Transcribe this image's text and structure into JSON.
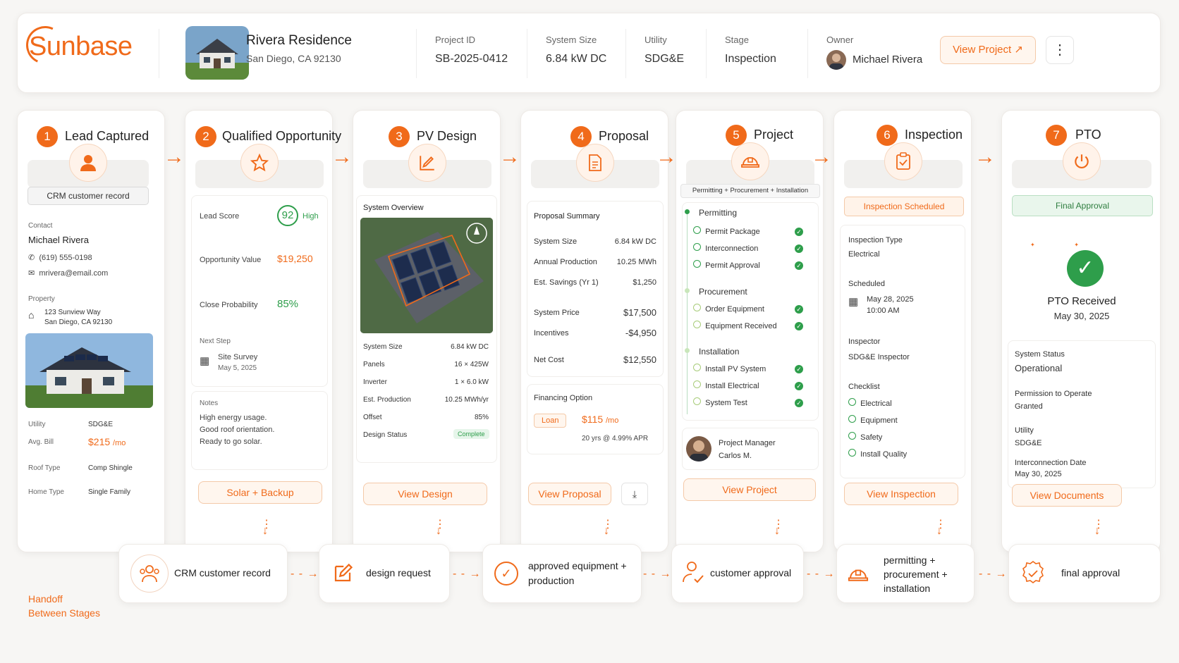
{
  "header": {
    "logo": "Sunbase",
    "project_name": "Rivera Residence",
    "address": "San Diego, CA 92130",
    "fields": [
      {
        "label": "Project ID",
        "value": "SB-2025-0412"
      },
      {
        "label": "System Size",
        "value": "6.84 kW DC"
      },
      {
        "label": "Utility",
        "value": "SDG&E"
      },
      {
        "label": "Stage",
        "value": "Inspection"
      }
    ],
    "owner_label": "Owner",
    "owner_name": "Michael Rivera",
    "view_project": "View Project"
  },
  "stages": [
    {
      "num": "1",
      "title": "Lead Captured",
      "icon": "user-icon"
    },
    {
      "num": "2",
      "title": "Qualified Opportunity",
      "icon": "star-icon"
    },
    {
      "num": "3",
      "title": "PV Design",
      "icon": "design-pencil-icon"
    },
    {
      "num": "4",
      "title": "Proposal",
      "icon": "document-icon"
    },
    {
      "num": "5",
      "title": "Project",
      "icon": "hardhat-icon"
    },
    {
      "num": "6",
      "title": "Inspection",
      "icon": "clipboard-check-icon"
    },
    {
      "num": "7",
      "title": "PTO",
      "icon": "power-icon"
    }
  ],
  "lead": {
    "badge": "CRM customer record",
    "contact_label": "Contact",
    "name": "Michael Rivera",
    "phone": "(619) 555-0198",
    "email": "mrivera@email.com",
    "property_label": "Property",
    "street": "123 Sunview Way",
    "city": "San Diego, CA 92130",
    "utility_label": "Utility",
    "utility": "SDG&E",
    "bill_label": "Avg. Bill",
    "bill": "$215",
    "bill_unit": "/mo",
    "roof_label": "Roof Type",
    "roof": "Comp Shingle",
    "home_label": "Home Type",
    "home": "Single Family"
  },
  "qualified": {
    "score_label": "Lead Score",
    "score": "92",
    "score_level": "High",
    "value_label": "Opportunity Value",
    "value": "$19,250",
    "prob_label": "Close Probability",
    "prob": "85%",
    "next_label": "Next Step",
    "next": "Site Survey",
    "next_date": "May 5, 2025",
    "notes_label": "Notes",
    "notes": [
      "High energy usage.",
      "Good roof orientation.",
      "Ready to go solar."
    ],
    "button": "Solar + Backup"
  },
  "design": {
    "overview": "System Overview",
    "rows": [
      {
        "k": "System Size",
        "v": "6.84 kW DC"
      },
      {
        "k": "Panels",
        "v": "16 × 425W"
      },
      {
        "k": "Inverter",
        "v": "1 × 6.0 kW"
      },
      {
        "k": "Est. Production",
        "v": "10.25 MWh/yr"
      },
      {
        "k": "Offset",
        "v": "85%"
      }
    ],
    "status_label": "Design Status",
    "status": "Complete",
    "button": "View Design"
  },
  "proposal": {
    "summary": "Proposal Summary",
    "rows": [
      {
        "k": "System Size",
        "v": "6.84 kW DC"
      },
      {
        "k": "Annual Production",
        "v": "10.25 MWh"
      },
      {
        "k": "Est. Savings (Yr 1)",
        "v": "$1,250"
      }
    ],
    "price_label": "System Price",
    "price": "$17,500",
    "inc_label": "Incentives",
    "inc": "-$4,950",
    "net_label": "Net Cost",
    "net": "$12,550",
    "fin_label": "Financing Option",
    "loan": "Loan",
    "monthly": "$115",
    "monthly_unit": "/mo",
    "terms": "20 yrs @ 4.99% APR",
    "button": "View Proposal"
  },
  "project": {
    "tag": "Permitting + Procurement + Installation",
    "groups": [
      {
        "title": "Permitting",
        "items": [
          "Permit Package",
          "Interconnection",
          "Permit Approval"
        ]
      },
      {
        "title": "Procurement",
        "items": [
          "Order Equipment",
          "Equipment Received"
        ]
      },
      {
        "title": "Installation",
        "items": [
          "Install PV System",
          "Install Electrical",
          "System Test"
        ]
      }
    ],
    "pm_label": "Project Manager",
    "pm": "Carlos M.",
    "button": "View Project"
  },
  "inspection": {
    "badge": "Inspection Scheduled",
    "type_label": "Inspection Type",
    "type": "Electrical",
    "sched_label": "Scheduled",
    "date": "May 28, 2025",
    "time": "10:00 AM",
    "inspector_label": "Inspector",
    "inspector": "SDG&E Inspector",
    "checklist_label": "Checklist",
    "checklist": [
      "Electrical",
      "Equipment",
      "Safety",
      "Install Quality"
    ],
    "button": "View Inspection"
  },
  "pto": {
    "badge": "Final Approval",
    "received": "PTO Received",
    "received_date": "May 30, 2025",
    "status_label": "System Status",
    "status": "Operational",
    "perm_label": "Permission to Operate",
    "perm": "Granted",
    "utility_label": "Utility",
    "utility": "SDG&E",
    "ic_label": "Interconnection Date",
    "ic_date": "May 30, 2025",
    "button": "View Documents"
  },
  "handoff": {
    "title_line1": "Handoff",
    "title_line2": "Between Stages",
    "items": [
      "CRM customer record",
      "design request",
      "approved equipment + production",
      "customer approval",
      "permitting + procurement + installation",
      "final approval"
    ]
  },
  "colors": {
    "accent": "#f06a1a",
    "success": "#2e9e4b"
  }
}
